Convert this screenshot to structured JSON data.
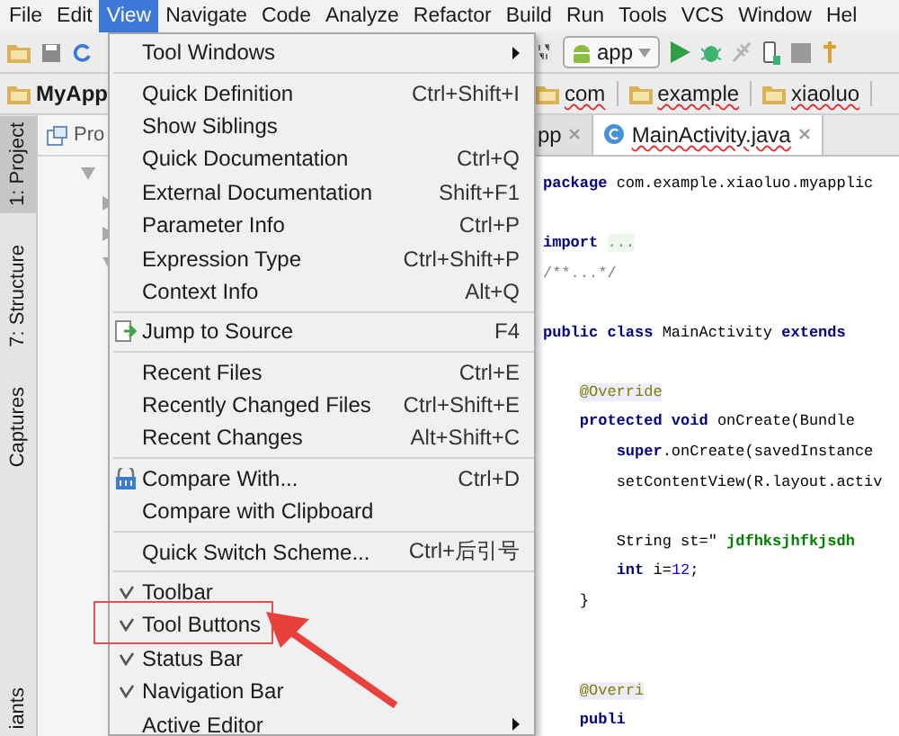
{
  "menu_bar": [
    {
      "label": "File",
      "selected": false
    },
    {
      "label": "Edit",
      "selected": false
    },
    {
      "label": "View",
      "selected": true
    },
    {
      "label": "Navigate",
      "selected": false
    },
    {
      "label": "Code",
      "selected": false
    },
    {
      "label": "Analyze",
      "selected": false
    },
    {
      "label": "Refactor",
      "selected": false
    },
    {
      "label": "Build",
      "selected": false
    },
    {
      "label": "Run",
      "selected": false
    },
    {
      "label": "Tools",
      "selected": false
    },
    {
      "label": "VCS",
      "selected": false
    },
    {
      "label": "Window",
      "selected": false
    },
    {
      "label": "Hel",
      "selected": false
    }
  ],
  "toolbar": {
    "run_config": "app"
  },
  "nav_bar": {
    "project": "MyApp",
    "crumbs": [
      "com",
      "example",
      "xiaoluo"
    ]
  },
  "left_strip": [
    {
      "label": "1: Project",
      "selected": true
    },
    {
      "label": "7: Structure",
      "selected": false
    },
    {
      "label": "Captures",
      "selected": false
    },
    {
      "label": "iants",
      "selected": false
    }
  ],
  "project_panel": {
    "title": "Pro"
  },
  "editor_tabs": [
    {
      "label": "pp",
      "selected": false
    },
    {
      "label": "MainActivity.java",
      "selected": true
    }
  ],
  "code": [
    {
      "kind": "code",
      "tokens": [
        {
          "t": "package",
          "kind": "keyword"
        },
        {
          "t": " com.example.xiaoluo.myapplic",
          "kind": "plain"
        }
      ]
    },
    {
      "kind": "blank"
    },
    {
      "kind": "code",
      "tokens": [
        {
          "t": "import",
          "kind": "keyword"
        },
        {
          "t": " ...",
          "kind": "fold"
        }
      ]
    },
    {
      "kind": "code",
      "tokens": [
        {
          "t": "/**...*/",
          "kind": "comment"
        }
      ]
    },
    {
      "kind": "blank"
    },
    {
      "kind": "code",
      "tokens": [
        {
          "t": "public class",
          "kind": "keyword"
        },
        {
          "t": " MainActivity ",
          "kind": "plain"
        },
        {
          "t": "extends",
          "kind": "keyword"
        }
      ]
    },
    {
      "kind": "blank"
    },
    {
      "kind": "code",
      "tokens": [
        {
          "t": "    @Override",
          "kind": "annotation"
        }
      ]
    },
    {
      "kind": "code",
      "tokens": [
        {
          "t": "    protected void",
          "kind": "keyword"
        },
        {
          "t": " onCreate(Bundle",
          "kind": "plain"
        }
      ]
    },
    {
      "kind": "code",
      "tokens": [
        {
          "t": "        super",
          "kind": "keyword"
        },
        {
          "t": ".onCreate(savedInstance",
          "kind": "plain"
        }
      ]
    },
    {
      "kind": "code",
      "tokens": [
        {
          "t": "        setContentView(R.layout.activ",
          "kind": "plain"
        }
      ]
    },
    {
      "kind": "blank"
    },
    {
      "kind": "code",
      "tokens": [
        {
          "t": "        String st=\" ",
          "kind": "plain"
        },
        {
          "t": "jdfhksjhfkjsdh",
          "kind": "string"
        }
      ]
    },
    {
      "kind": "code",
      "tokens": [
        {
          "t": "        int",
          "kind": "keyword"
        },
        {
          "t": " i=",
          "kind": "plain"
        },
        {
          "t": "12",
          "kind": "number"
        },
        {
          "t": ";",
          "kind": "plain"
        }
      ]
    },
    {
      "kind": "code",
      "tokens": [
        {
          "t": "    }",
          "kind": "plain"
        }
      ]
    },
    {
      "kind": "blank"
    },
    {
      "kind": "blank"
    },
    {
      "kind": "code",
      "tokens": [
        {
          "t": "    @Overri",
          "kind": "annotation"
        }
      ]
    },
    {
      "kind": "code",
      "tokens": [
        {
          "t": "    publi",
          "kind": "keyword"
        }
      ]
    }
  ],
  "view_menu": [
    {
      "kind": "item",
      "label": "Tool Windows",
      "submenu": true
    },
    {
      "kind": "separator"
    },
    {
      "kind": "item",
      "label": "Quick Definition",
      "shortcut": "Ctrl+Shift+I"
    },
    {
      "kind": "item",
      "label": "Show Siblings"
    },
    {
      "kind": "item",
      "label": "Quick Documentation",
      "shortcut": "Ctrl+Q"
    },
    {
      "kind": "item",
      "label": "External Documentation",
      "shortcut": "Shift+F1"
    },
    {
      "kind": "item",
      "label": "Parameter Info",
      "shortcut": "Ctrl+P"
    },
    {
      "kind": "item",
      "label": "Expression Type",
      "shortcut": "Ctrl+Shift+P"
    },
    {
      "kind": "item",
      "label": "Context Info",
      "shortcut": "Alt+Q"
    },
    {
      "kind": "separator"
    },
    {
      "kind": "jump",
      "label": "Jump to Source",
      "shortcut": "F4"
    },
    {
      "kind": "separator"
    },
    {
      "kind": "item",
      "label": "Recent Files",
      "shortcut": "Ctrl+E"
    },
    {
      "kind": "item",
      "label": "Recently Changed Files",
      "shortcut": "Ctrl+Shift+E"
    },
    {
      "kind": "item",
      "label": "Recent Changes",
      "shortcut": "Alt+Shift+C"
    },
    {
      "kind": "separator"
    },
    {
      "kind": "compare",
      "label": "Compare With...",
      "shortcut": "Ctrl+D"
    },
    {
      "kind": "item",
      "label": "Compare with Clipboard"
    },
    {
      "kind": "separator"
    },
    {
      "kind": "item",
      "label": "Quick Switch Scheme...",
      "shortcut": "Ctrl+后引号"
    },
    {
      "kind": "separator"
    },
    {
      "kind": "toggle",
      "label": "Toolbar",
      "checked": true
    },
    {
      "kind": "toggle",
      "label": "Tool Buttons",
      "checked": true,
      "highlighted": true
    },
    {
      "kind": "toggle",
      "label": "Status Bar",
      "checked": true
    },
    {
      "kind": "toggle",
      "label": "Navigation Bar",
      "checked": true
    },
    {
      "kind": "item",
      "label": "Active Editor",
      "submenu": true
    }
  ]
}
